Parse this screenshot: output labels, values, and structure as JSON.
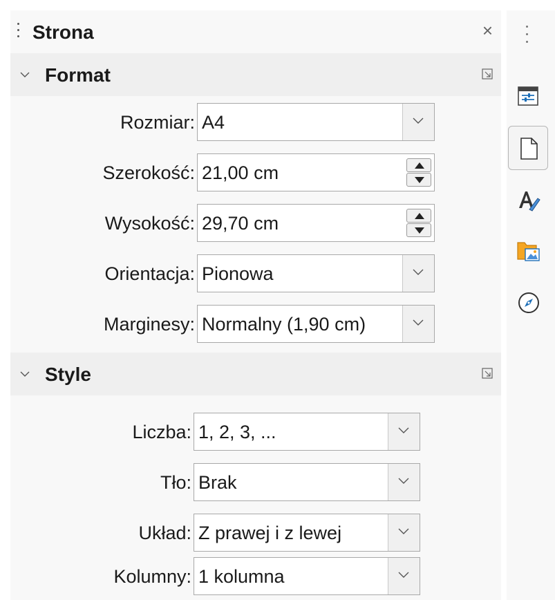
{
  "panel": {
    "title": "Strona",
    "close_glyph": "×"
  },
  "format": {
    "title": "Format",
    "rows": [
      {
        "label": "Rozmiar:",
        "value": "A4",
        "control": "dropdown"
      },
      {
        "label": "Szerokość:",
        "value": "21,00 cm",
        "control": "spin"
      },
      {
        "label": "Wysokość:",
        "value": "29,70 cm",
        "control": "spin"
      },
      {
        "label": "Orientacja:",
        "value": "Pionowa",
        "control": "dropdown"
      },
      {
        "label": "Marginesy:",
        "value": "Normalny (1,90 cm)",
        "control": "dropdown"
      }
    ]
  },
  "style": {
    "title": "Style",
    "rows": [
      {
        "label": "Liczba:",
        "value": "1, 2, 3, ...",
        "control": "dropdown"
      },
      {
        "label": "Tło:",
        "value": "Brak",
        "control": "dropdown"
      },
      {
        "label": "Układ:",
        "value": "Z prawej i z lewej",
        "control": "dropdown"
      },
      {
        "label": "Kolumny:",
        "value": "1 kolumna",
        "control": "dropdown"
      }
    ]
  },
  "tabbar": {
    "tabs": [
      {
        "icon": "properties-icon",
        "active": false
      },
      {
        "icon": "page-icon",
        "active": true
      },
      {
        "icon": "styles-icon",
        "active": false
      },
      {
        "icon": "gallery-icon",
        "active": false
      },
      {
        "icon": "navigator-icon",
        "active": false
      }
    ]
  },
  "colors": {
    "accent_blue": "#1e6fb8",
    "folder_orange": "#f5a623"
  }
}
